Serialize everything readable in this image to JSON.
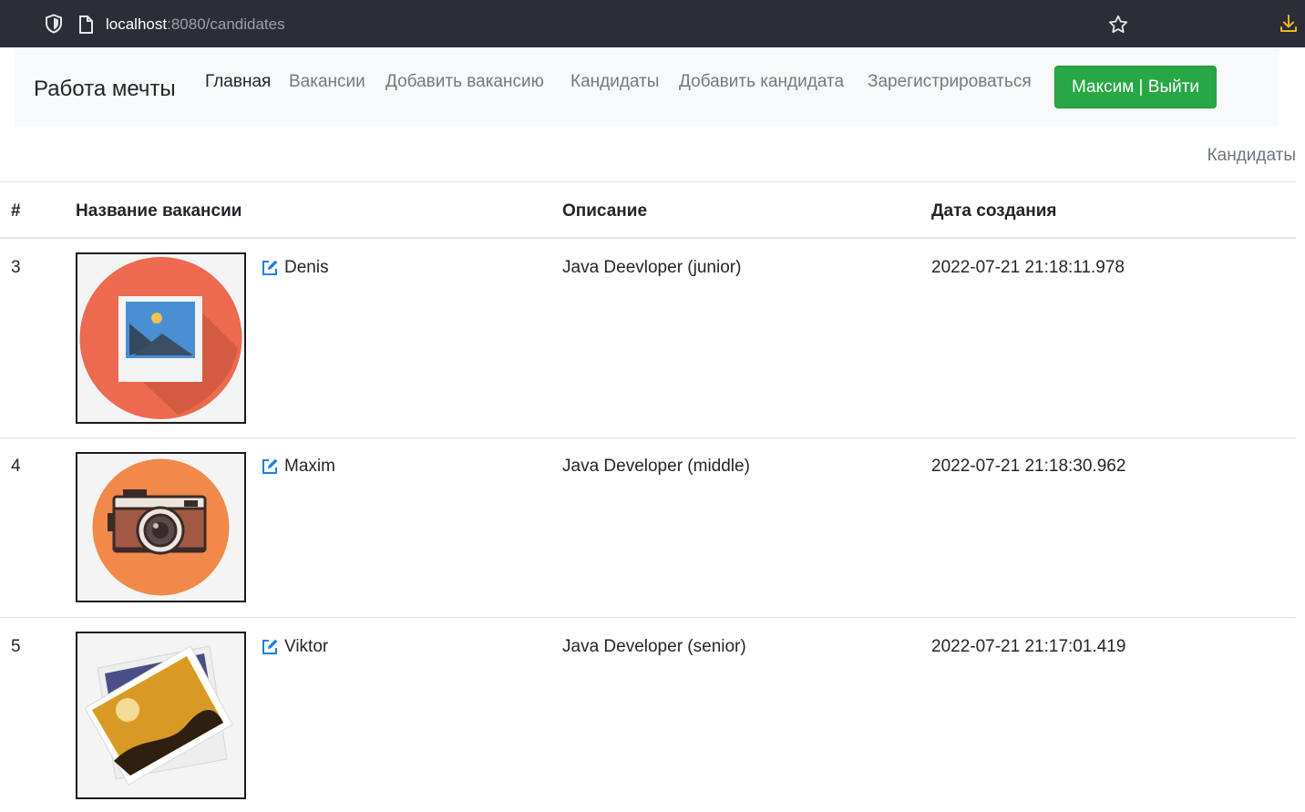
{
  "browser": {
    "url_host": "localhost",
    "url_path": ":8080/candidates"
  },
  "navbar": {
    "brand": "Работа мечты",
    "links": [
      {
        "label": "Главная",
        "active": true
      },
      {
        "label": "Вакансии",
        "active": false
      },
      {
        "label": "Добавить вакансию",
        "active": false
      },
      {
        "label": "Кандидаты",
        "active": false
      },
      {
        "label": "Добавить кандидата",
        "active": false
      },
      {
        "label": "Зарегистрироваться",
        "active": false
      }
    ],
    "user_button": "Максим | Выйти"
  },
  "section_label": "Кандидаты",
  "table": {
    "headers": [
      "#",
      "Название вакансии",
      "Описание",
      "Дата создания"
    ],
    "rows": [
      {
        "id": "3",
        "name": "Denis",
        "description": "Java Deevloper (junior)",
        "created": "2022-07-21 21:18:11.978",
        "photo": "picture-icon"
      },
      {
        "id": "4",
        "name": "Maxim",
        "description": "Java Developer (middle)",
        "created": "2022-07-21 21:18:30.962",
        "photo": "camera-icon"
      },
      {
        "id": "5",
        "name": "Viktor",
        "description": "Java Developer (senior)",
        "created": "2022-07-21 21:17:01.419",
        "photo": "photos-icon"
      }
    ]
  },
  "colors": {
    "chrome_bg": "#2b2d37",
    "navbar_bg": "#f8f9fa",
    "success": "#28a745",
    "link_blue": "#1e7fe0",
    "download_accent": "#f0b429"
  }
}
